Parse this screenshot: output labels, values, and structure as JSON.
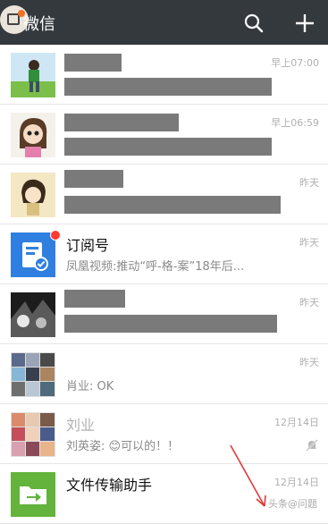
{
  "header": {
    "title": "微信"
  },
  "chats": [
    {
      "title": "",
      "message": "",
      "time": "早上07:00"
    },
    {
      "title": "",
      "message": "",
      "time": "早上06:59"
    },
    {
      "title": "",
      "message": "",
      "time": "昨天"
    },
    {
      "title": "订阅号",
      "message": "凤凰视频:推动“呼-格-案”18年后...",
      "time": "昨天"
    },
    {
      "title": "",
      "message": "",
      "time": "昨天"
    },
    {
      "title": "",
      "message": "肖业: OK",
      "time": "昨天"
    },
    {
      "title": "刘业",
      "message": "刘英姿: 😊可以的！！",
      "time": "12月14日"
    },
    {
      "title": "文件传输助手",
      "message": "",
      "time": "12月14日"
    }
  ],
  "watermark": "头条@问题",
  "colors": {
    "topbar": "#34393d",
    "unread": "#ff3b30"
  }
}
